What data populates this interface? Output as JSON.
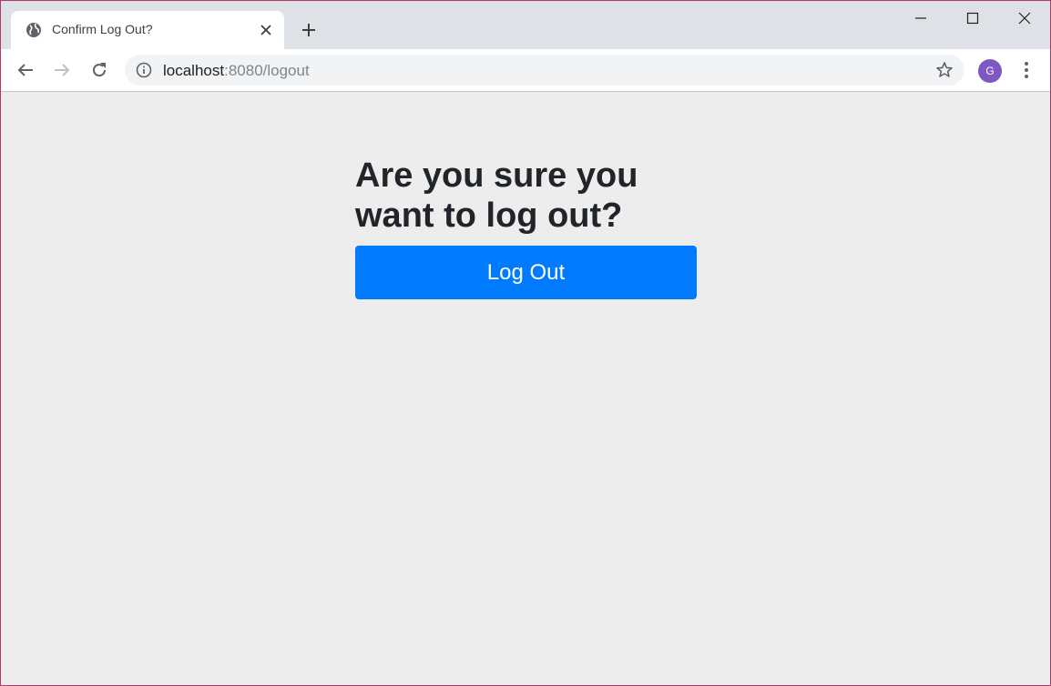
{
  "browser": {
    "tab": {
      "title": "Confirm Log Out?"
    },
    "address_bar": {
      "host": "localhost",
      "rest": ":8080/logout"
    },
    "profile_initial": "G"
  },
  "page": {
    "heading": "Are you sure you want to log out?",
    "logout_button_label": "Log Out"
  },
  "colors": {
    "primary_button": "#007bff",
    "page_background": "#ededee",
    "avatar": "#7e57c2"
  }
}
